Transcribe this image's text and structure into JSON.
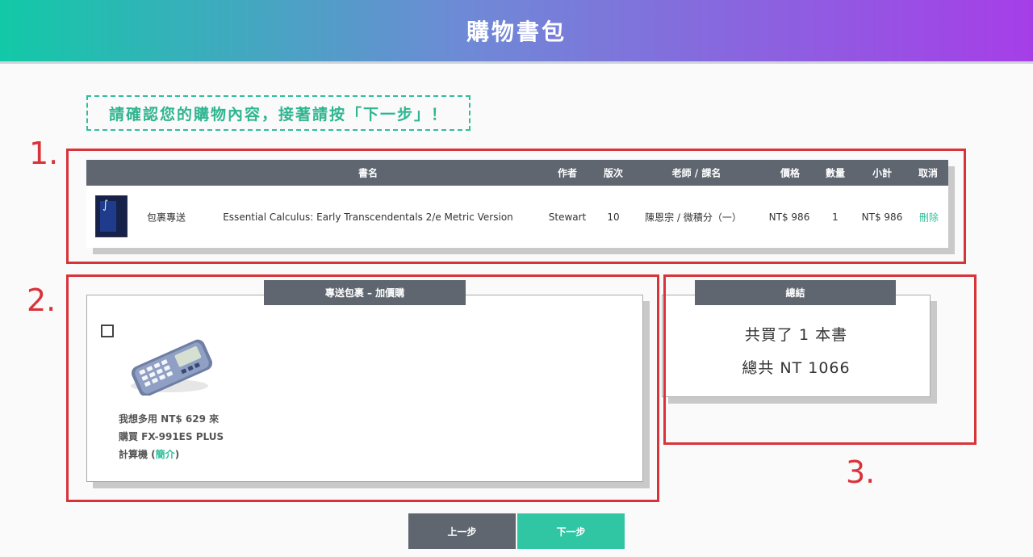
{
  "header": {
    "title": "購物書包"
  },
  "notice": "請確認您的購物內容，接著請按「下一步」！",
  "annotations": [
    "1.",
    "2.",
    "3."
  ],
  "cart": {
    "columns": [
      "書名",
      "作者",
      "版次",
      "老師 / 課名",
      "價格",
      "數量",
      "小計",
      "取消"
    ],
    "rows": [
      {
        "delivery": "包裹專送",
        "title": "Essential Calculus: Early Transcendentals 2/e Metric Version",
        "author": "Stewart",
        "edition": "10",
        "teacher_course": "陳恩宗 / 微積分（一）",
        "price": "NT$ 986",
        "quantity": "1",
        "subtotal": "NT$ 986",
        "remove": "刪除"
      }
    ]
  },
  "addon": {
    "tab": "專送包裹 – 加價購",
    "line1": "我想多用 NT$ 629 來",
    "line2": "購買 FX-991ES PLUS",
    "line3_prefix": "計算機 (",
    "line3_link": "簡介",
    "line3_suffix": ")",
    "checked": false
  },
  "summary": {
    "tab": "總結",
    "count_line": "共買了 1 本書",
    "total_line": "總共 NT 1066"
  },
  "buttons": {
    "prev": "上一步",
    "next": "下一步"
  },
  "colors": {
    "accent": "#30c6a4",
    "dark": "#5f6670",
    "annotation": "#d9333a"
  }
}
